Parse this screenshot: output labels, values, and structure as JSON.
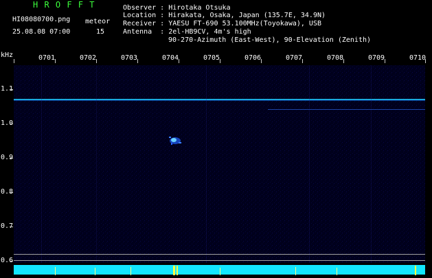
{
  "header": {
    "title": "H R O F F T",
    "filename": "HI08080700.png",
    "datetime": "25.08.08 07:00",
    "meteor_label": "meteor",
    "meteor_count": "15",
    "observer_label": "Observer : ",
    "observer": "Hirotaka Otsuka",
    "location_label": "Location : ",
    "location": "Hirakata, Osaka, Japan (135.7E, 34.9N)",
    "receiver_label": "Receiver : ",
    "receiver": "YAESU FT-690 53.100MHz(Toyokawa), USB",
    "antenna_label": "Antenna  : ",
    "antenna": "2el-HB9CV, 4m's high",
    "antenna_line2": "90-270-Azimuth (East-West), 90-Elevation (Zenith)"
  },
  "axes": {
    "y_unit": "kHz",
    "x_ticks": [
      "0701",
      "0702",
      "0703",
      "0704",
      "0705",
      "0706",
      "0707",
      "0708",
      "0709",
      "0710"
    ],
    "y_ticks": [
      "1.1",
      "1.0",
      "0.9",
      "0.8",
      "0.7",
      "0.6"
    ]
  },
  "colors": {
    "background": "#000000",
    "plot_background": "#00001c",
    "title_green": "#3cff3c",
    "carrier_line": "#1ec8ff",
    "bottom_bar": "#12e6ff",
    "meteor_echo": "#4aa0ff"
  }
}
